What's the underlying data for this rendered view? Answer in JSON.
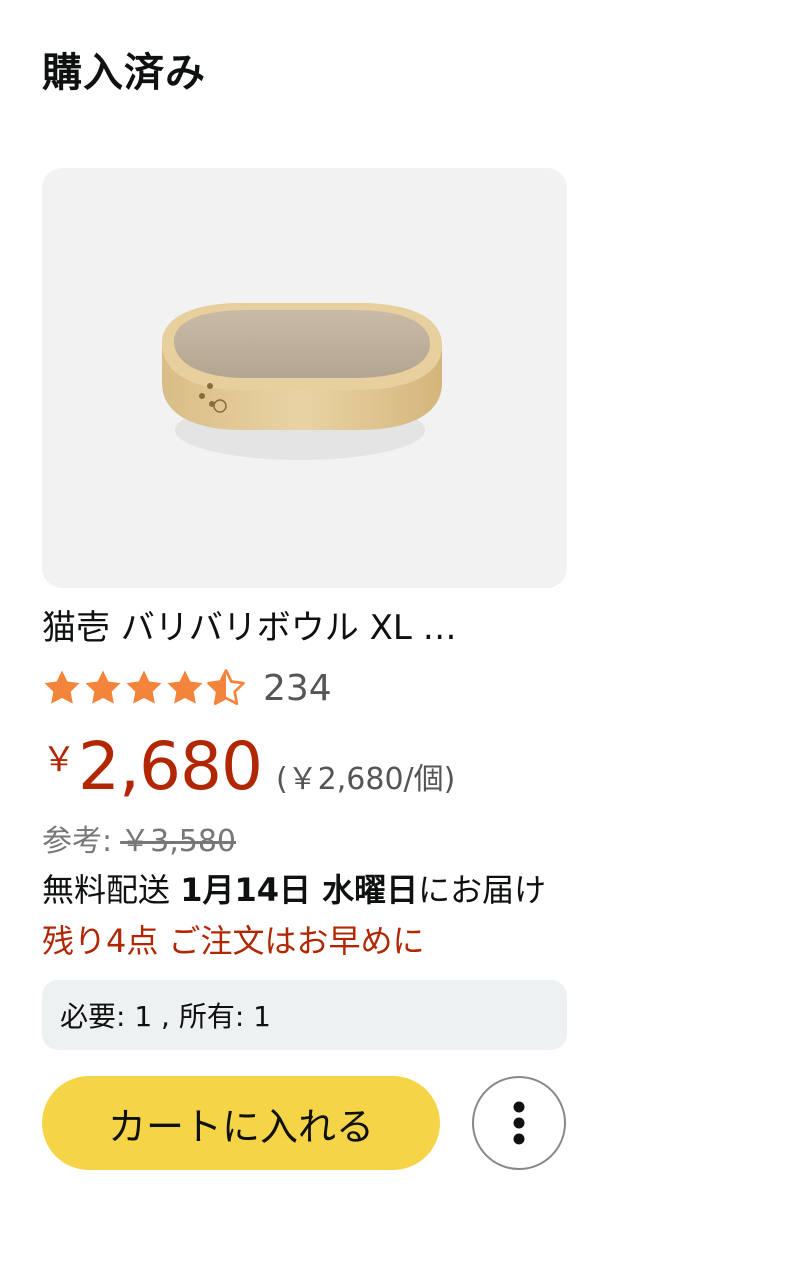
{
  "section": {
    "title": "購入済み"
  },
  "product": {
    "title": "猫壱 バリバリボウル XL …",
    "rating": 4.5,
    "rating_count": "234",
    "price_symbol": "￥",
    "price": "2,680",
    "unit_price": "(￥2,680/個)",
    "list_price_label": "参考:",
    "list_price": "￥3,580",
    "delivery_prefix": "無料配送",
    "delivery_date": "1月14日 水曜日",
    "delivery_suffix": "にお届け",
    "stock_message": "残り4点 ご注文はお早めに",
    "quantity_info": "必要: 1 , 所有: 1",
    "image_icon": "cardboard-scratcher-bowl-image"
  },
  "actions": {
    "add_to_cart_label": "カートに入れる",
    "more_icon": "more-vertical-icon"
  },
  "colors": {
    "star": "#f3843b",
    "price": "#b12704",
    "cart_button": "#f5d547"
  }
}
